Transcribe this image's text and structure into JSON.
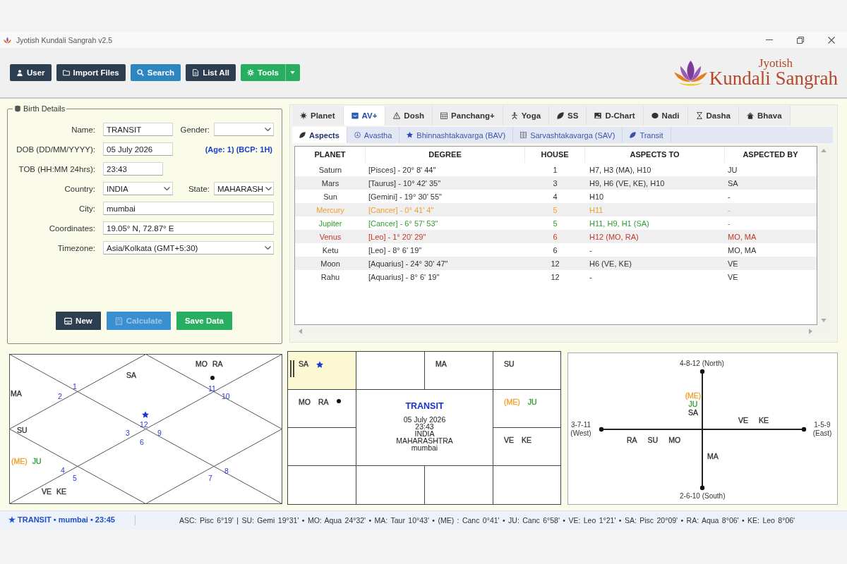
{
  "window": {
    "title": "Jyotish Kundali Sangrah v2.5"
  },
  "toolbar": {
    "buttons": [
      {
        "label": "User",
        "color": "#2c3e50",
        "has_menu": false
      },
      {
        "label": "Import Files",
        "color": "#2c3e50",
        "has_menu": false
      },
      {
        "label": "Search",
        "color": "#2e86c1",
        "has_menu": false
      },
      {
        "label": "List All",
        "color": "#2c3e50",
        "has_menu": false
      },
      {
        "label": "Tools",
        "color": "#27ae60",
        "has_menu": true
      }
    ]
  },
  "logo": {
    "line_1": "Jyotish",
    "line_2": "Kundali Sangrah"
  },
  "birth_details": {
    "title": "Birth Details",
    "rows": [
      {
        "fields": [
          {
            "label": "Name:",
            "kind": "text",
            "value": "TRANSIT"
          },
          {
            "label": "Gender:",
            "kind": "select"
          }
        ]
      },
      {
        "fields": [
          {
            "label": "DOB (DD/MM/YYYY):",
            "kind": "text",
            "value": "05 July 2026"
          }
        ],
        "note": "(Age: 1) (BCP: 1H)"
      },
      {
        "fields": [
          {
            "label": "TOB (HH:MM 24hrs):",
            "kind": "time",
            "value": "23:43"
          }
        ]
      },
      {
        "fields": [
          {
            "label": "Country:",
            "kind": "select",
            "value": "INDIA"
          },
          {
            "label": "State:",
            "kind": "select",
            "value": "MAHARASH"
          }
        ]
      },
      {
        "fields": [
          {
            "label": "City:",
            "kind": "text",
            "value": "mumbai"
          }
        ]
      },
      {
        "fields": [
          {
            "label": "Coordinates:",
            "kind": "text",
            "value": "19.05° N, 72.87° E"
          }
        ]
      },
      {
        "fields": [
          {
            "label": "Timezone:",
            "kind": "select",
            "value": "Asia/Kolkata (GMT+5:30)"
          }
        ]
      }
    ],
    "buttons": [
      {
        "label": "New",
        "color": "#2c3e50",
        "disabled": false
      },
      {
        "label": "Calculate",
        "color": "#3a8fd0",
        "disabled": true
      },
      {
        "label": "Save Data",
        "color": "#27ae60",
        "disabled": false
      }
    ]
  },
  "tabs": [
    {
      "label": "Planet",
      "selected": false
    },
    {
      "label": "AV+",
      "selected": true
    },
    {
      "label": "Dosh",
      "selected": false
    },
    {
      "label": "Panchang+",
      "selected": false
    },
    {
      "label": "Yoga",
      "selected": false
    },
    {
      "label": "SS",
      "selected": false
    },
    {
      "label": "D-Chart",
      "selected": false
    },
    {
      "label": "Nadi",
      "selected": false
    },
    {
      "label": "Dasha",
      "selected": false
    },
    {
      "label": "Bhava",
      "selected": false
    }
  ],
  "subtabs": [
    {
      "label": "Aspects",
      "selected": true
    },
    {
      "label": "Avastha",
      "selected": false
    },
    {
      "label": "Bhinnashtakavarga (BAV)",
      "selected": false
    },
    {
      "label": "Sarvashtakavarga (SAV)",
      "selected": false
    },
    {
      "label": "Transit",
      "selected": false
    }
  ],
  "aspects_table": {
    "columns": [
      "PLANET",
      "DEGREE",
      "HOUSE",
      "ASPECTS TO",
      "ASPECTED BY"
    ],
    "rows": [
      {
        "color": "#333333",
        "cells": [
          "Saturn",
          "[Pisces] - 20° 8' 44\"",
          "1",
          "H7, H3 (MA), H10",
          "JU"
        ]
      },
      {
        "color": "#333333",
        "cells": [
          "Mars",
          "[Taurus] - 10° 42' 35\"",
          "3",
          "H9, H6 (VE, KE), H10",
          "SA"
        ]
      },
      {
        "color": "#333333",
        "cells": [
          "Sun",
          "[Gemini] - 19° 30' 55\"",
          "4",
          "H10",
          "-"
        ]
      },
      {
        "color": "#f0a030",
        "cells": [
          "Mercury",
          "[Cancer] - 0° 41' 4\"",
          "5",
          "H11",
          "-"
        ]
      },
      {
        "color": "#2e9e2e",
        "cells": [
          "Jupiter",
          "[Cancer] - 6° 57' 53\"",
          "5",
          "H11, H9, H1 (SA)",
          "-"
        ]
      },
      {
        "color": "#c0392b",
        "cells": [
          "Venus",
          "[Leo] - 1° 20' 29\"",
          "6",
          "H12 (MO, RA)",
          "MO, MA"
        ]
      },
      {
        "color": "#333333",
        "cells": [
          "Ketu",
          "[Leo] - 8° 6' 19\"",
          "6",
          "-",
          "MO, MA"
        ]
      },
      {
        "color": "#333333",
        "cells": [
          "Moon",
          "[Aquarius] - 24° 30' 47\"",
          "12",
          "H6 (VE, KE)",
          "VE"
        ]
      },
      {
        "color": "#333333",
        "cells": [
          "Rahu",
          "[Aquarius] - 8° 6' 19\"",
          "12",
          "-",
          "VE"
        ]
      }
    ]
  },
  "north_chart": {
    "houses": [
      {
        "sign": "12",
        "planets": [
          {
            "abbr": "SA",
            "color": "#333333"
          }
        ],
        "marks": [
          {
            "kind": "star"
          }
        ]
      },
      {
        "sign": "1"
      },
      {
        "sign": "2",
        "planets": [
          {
            "abbr": "MA",
            "color": "#333333"
          }
        ]
      },
      {
        "sign": "3",
        "planets": [
          {
            "abbr": "SU",
            "color": "#333333"
          }
        ]
      },
      {
        "sign": "4",
        "planets": [
          {
            "abbr": "(ME)",
            "color": "#f0a030"
          },
          {
            "abbr": "JU",
            "color": "#2e9e2e"
          }
        ]
      },
      {
        "sign": "5",
        "planets": [
          {
            "abbr": "VE",
            "color": "#333333"
          },
          {
            "abbr": "KE",
            "color": "#333333"
          }
        ]
      },
      {
        "sign": "6"
      },
      {
        "sign": "7"
      },
      {
        "sign": "8"
      },
      {
        "sign": "9"
      },
      {
        "sign": "10"
      },
      {
        "sign": "11",
        "planets": [
          {
            "abbr": "MO",
            "color": "#333333"
          },
          {
            "abbr": "RA",
            "color": "#333333"
          }
        ],
        "marks": [
          {
            "kind": "dot"
          }
        ]
      }
    ]
  },
  "south_chart": {
    "cells": [
      {
        "ascendant": false
      },
      {
        "ascendant": false,
        "planets": [
          {
            "abbr": "MA",
            "color": "#333333"
          }
        ]
      },
      {
        "ascendant": false,
        "planets": [
          {
            "abbr": "SU",
            "color": "#333333"
          }
        ]
      },
      {
        "ascendant": false,
        "planets": [
          {
            "abbr": "(ME)",
            "color": "#f0a030"
          },
          {
            "abbr": "JU",
            "color": "#2e9e2e"
          }
        ]
      },
      {
        "ascendant": false,
        "planets": [
          {
            "abbr": "VE",
            "color": "#333333"
          },
          {
            "abbr": "KE",
            "color": "#333333"
          }
        ]
      },
      {
        "ascendant": false
      },
      {
        "ascendant": false
      },
      {
        "ascendant": false
      },
      {
        "ascendant": false
      },
      {
        "ascendant": false
      },
      {
        "ascendant": false,
        "planets": [
          {
            "abbr": "MO",
            "color": "#333333"
          },
          {
            "abbr": "RA",
            "color": "#333333"
          }
        ],
        "marks": [
          {
            "kind": "dot"
          }
        ]
      },
      {
        "ascendant": true,
        "planets": [
          {
            "abbr": "SA",
            "color": "#333333"
          }
        ],
        "marks": [
          {
            "kind": "star"
          }
        ]
      }
    ],
    "center": {
      "title": "TRANSIT",
      "lines": [
        "05 July 2026",
        "23:43",
        "INDIA",
        "MAHARASHTRA",
        "mumbai"
      ]
    }
  },
  "direction_chart": {
    "axes": [
      {
        "kind": "north",
        "label": "4-8-12 (North)"
      },
      {
        "kind": "west",
        "label": "3-7-11 (West)"
      },
      {
        "kind": "east",
        "label": "1-5-9 (East)"
      },
      {
        "kind": "south",
        "label": "2-6-10 (South)"
      }
    ],
    "groups": [
      {
        "kind": "north",
        "planets": [
          {
            "abbr": "(ME)",
            "color": "#f0a030"
          },
          {
            "abbr": "JU",
            "color": "#2e9e2e"
          },
          {
            "abbr": "SA",
            "color": "#333333"
          }
        ]
      },
      {
        "kind": "east",
        "planets": [
          {
            "abbr": "VE",
            "color": "#333333"
          },
          {
            "abbr": "KE",
            "color": "#333333"
          }
        ]
      },
      {
        "kind": "west",
        "planets": [
          {
            "abbr": "RA",
            "color": "#333333"
          },
          {
            "abbr": "SU",
            "color": "#333333"
          },
          {
            "abbr": "MO",
            "color": "#333333"
          }
        ]
      },
      {
        "kind": "south",
        "planets": [
          {
            "abbr": "MA",
            "color": "#333333"
          }
        ]
      }
    ]
  },
  "status_bar": {
    "summary": "★ TRANSIT • mumbai • 23:45",
    "positions": "ASC: Pisc 6°19' | SU: Gemi 19°31' • MO: Aqua 24°32' • MA: Taur 10°43' • (ME) : Canc 0°41' • JU: Canc 6°58' • VE: Leo 1°21' • SA: Pisc 20°09' • RA: Aqua 8°06' • KE: Leo 8°06'"
  }
}
